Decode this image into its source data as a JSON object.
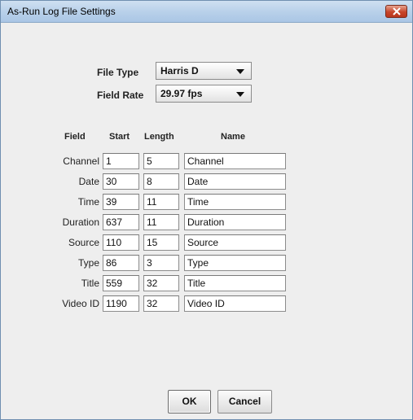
{
  "window": {
    "title": "As-Run Log File Settings",
    "close_icon": "close-icon"
  },
  "settings": {
    "file_type_label": "File Type",
    "file_type_value": "Harris D",
    "field_rate_label": "Field Rate",
    "field_rate_value": "29.97 fps"
  },
  "table": {
    "headers": {
      "field": "Field",
      "start": "Start",
      "length": "Length",
      "name": "Name"
    },
    "rows": [
      {
        "field": "Channel",
        "start": "1",
        "length": "5",
        "name": "Channel"
      },
      {
        "field": "Date",
        "start": "30",
        "length": "8",
        "name": "Date"
      },
      {
        "field": "Time",
        "start": "39",
        "length": "11",
        "name": "Time"
      },
      {
        "field": "Duration",
        "start": "637",
        "length": "11",
        "name": "Duration"
      },
      {
        "field": "Source",
        "start": "110",
        "length": "15",
        "name": "Source"
      },
      {
        "field": "Type",
        "start": "86",
        "length": "3",
        "name": "Type"
      },
      {
        "field": "Title",
        "start": "559",
        "length": "32",
        "name": "Title"
      },
      {
        "field": "Video ID",
        "start": "1190",
        "length": "32",
        "name": "Video ID"
      }
    ]
  },
  "buttons": {
    "ok": "OK",
    "cancel": "Cancel"
  }
}
